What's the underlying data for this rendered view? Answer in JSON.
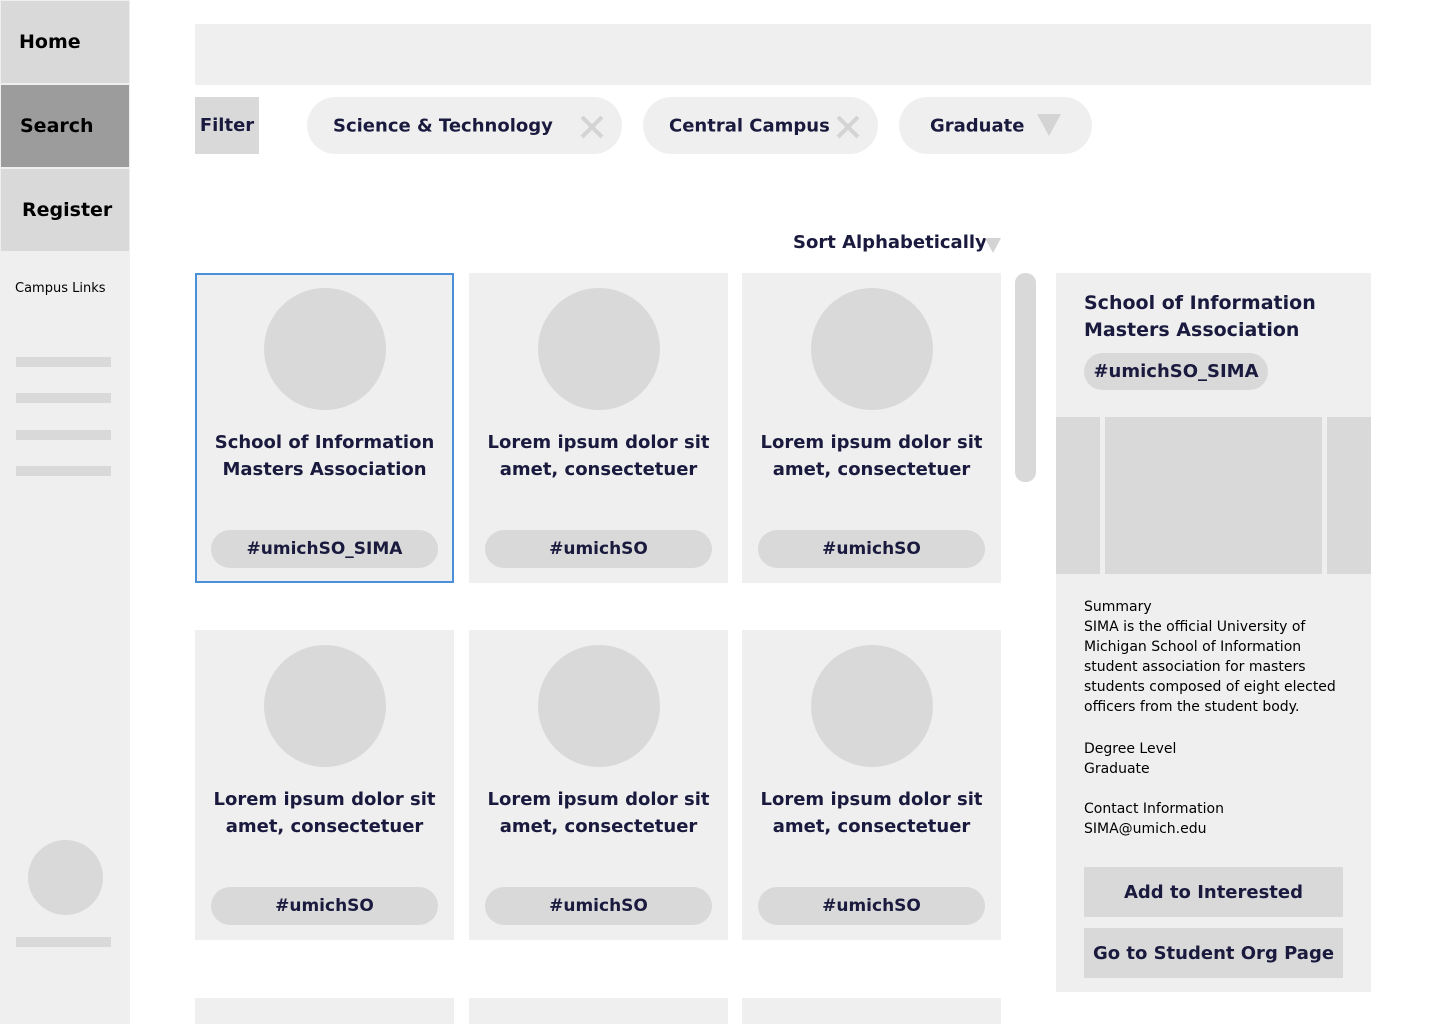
{
  "nav": {
    "home": "Home",
    "search": "Search",
    "register": "Register",
    "campus_links": "Campus Links"
  },
  "search": {
    "placeholder": ""
  },
  "filter": {
    "label": "Filter",
    "chips": [
      {
        "label": "Science & Technology",
        "icon": "close-icon"
      },
      {
        "label": "Central Campus",
        "icon": "close-icon"
      },
      {
        "label": "Graduate",
        "icon": "caret-down-icon"
      }
    ]
  },
  "sort": {
    "label": "Sort Alphabetically"
  },
  "cards": [
    {
      "title": "School of Information Masters Association",
      "tag": "#umichSO_SIMA",
      "selected": true
    },
    {
      "title": "Lorem ipsum dolor sit amet, consectetuer",
      "tag": "#umichSO"
    },
    {
      "title": "Lorem ipsum dolor sit amet, consectetuer",
      "tag": "#umichSO"
    },
    {
      "title": "Lorem ipsum dolor sit amet, consectetuer",
      "tag": "#umichSO"
    },
    {
      "title": "Lorem ipsum dolor sit amet, consectetuer",
      "tag": "#umichSO"
    },
    {
      "title": "Lorem ipsum dolor sit amet, consectetuer",
      "tag": "#umichSO"
    }
  ],
  "detail": {
    "title": "School of Information Masters Association",
    "tag": "#umichSO_SIMA",
    "summary_heading": "Summary",
    "summary_text": "SIMA is the official University of Michigan School of Information student association for masters students composed of eight elected officers from the student body.",
    "degree_heading": "Degree Level",
    "degree_value": "Graduate",
    "contact_heading": "Contact Information",
    "contact_value": "SIMA@umich.edu",
    "add_button": "Add to Interested",
    "go_button": "Go to Student Org Page"
  },
  "colors": {
    "sidebar_bg": "#efefef",
    "nav_button": "#d9d9d9",
    "nav_active": "#9c9c9c",
    "card_bg": "#efefef",
    "selected_border": "#4a90d9",
    "text": "#1a1a3e"
  }
}
